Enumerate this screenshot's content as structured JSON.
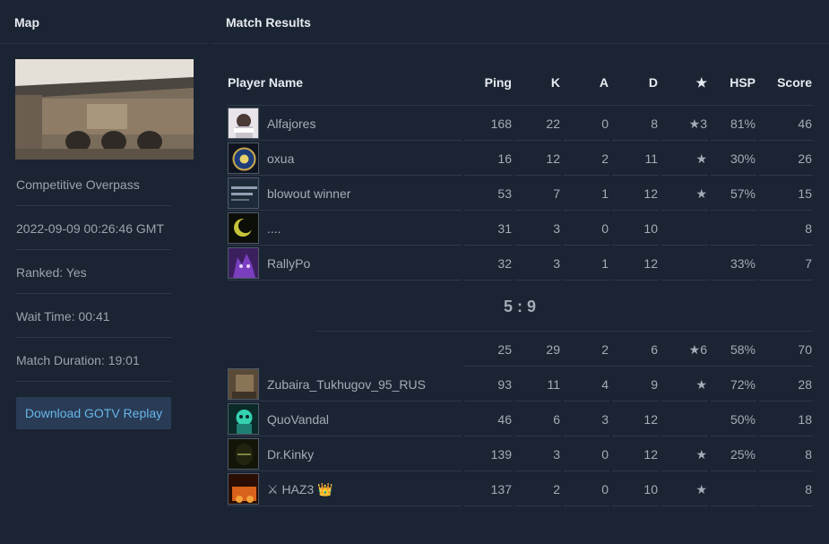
{
  "left": {
    "title": "Map",
    "map_name": "Competitive Overpass",
    "date": "2022-09-09 00:26:46 GMT",
    "ranked": "Ranked: Yes",
    "wait_time": "Wait Time: 00:41",
    "duration": "Match Duration: 19:01",
    "download_label": "Download GOTV Replay"
  },
  "results": {
    "title": "Match Results",
    "headers": {
      "player": "Player Name",
      "ping": "Ping",
      "k": "K",
      "a": "A",
      "d": "D",
      "star": "★",
      "hsp": "HSP",
      "score": "Score"
    },
    "team1": [
      {
        "name": "Alfajores",
        "ping": "168",
        "k": "22",
        "a": "0",
        "d": "8",
        "mvp": "★3",
        "hsp": "81%",
        "score": "46"
      },
      {
        "name": "oxua",
        "ping": "16",
        "k": "12",
        "a": "2",
        "d": "11",
        "mvp": "★",
        "hsp": "30%",
        "score": "26"
      },
      {
        "name": "blowout winner",
        "ping": "53",
        "k": "7",
        "a": "1",
        "d": "12",
        "mvp": "★",
        "hsp": "57%",
        "score": "15"
      },
      {
        "name": "....",
        "ping": "31",
        "k": "3",
        "a": "0",
        "d": "10",
        "mvp": "",
        "hsp": "",
        "score": "8"
      },
      {
        "name": "RallyPo",
        "ping": "32",
        "k": "3",
        "a": "1",
        "d": "12",
        "mvp": "",
        "hsp": "33%",
        "score": "7"
      }
    ],
    "match_score": "5 : 9",
    "team2_summary": {
      "ping": "25",
      "k": "29",
      "a": "2",
      "d": "6",
      "mvp": "★6",
      "hsp": "58%",
      "score": "70"
    },
    "team2": [
      {
        "name": "Zubaira_Tukhugov_95_RUS",
        "ping": "93",
        "k": "11",
        "a": "4",
        "d": "9",
        "mvp": "★",
        "hsp": "72%",
        "score": "28"
      },
      {
        "name": "QuoVandal",
        "ping": "46",
        "k": "6",
        "a": "3",
        "d": "12",
        "mvp": "",
        "hsp": "50%",
        "score": "18"
      },
      {
        "name": "Dr.Kinky",
        "ping": "139",
        "k": "3",
        "a": "0",
        "d": "12",
        "mvp": "★",
        "hsp": "25%",
        "score": "8"
      },
      {
        "name": "⚔ HAZ3 👑",
        "ping": "137",
        "k": "2",
        "a": "0",
        "d": "10",
        "mvp": "★",
        "hsp": "",
        "score": "8"
      }
    ]
  }
}
